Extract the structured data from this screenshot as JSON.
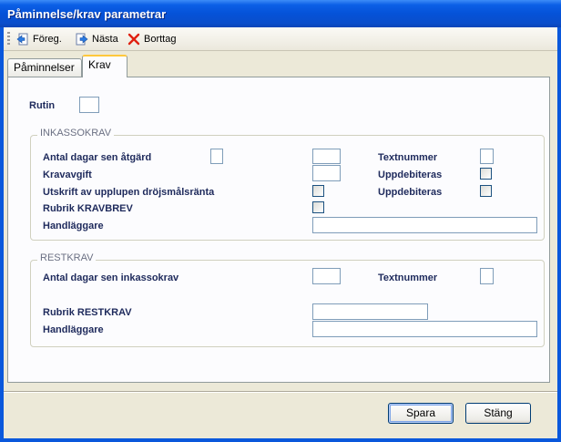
{
  "window": {
    "title": "Påminnelse/krav parametrar"
  },
  "toolbar": {
    "prev": "Föreg.",
    "next": "Nästa",
    "delete": "Borttag"
  },
  "tabs": [
    {
      "label": "Påminnelser"
    },
    {
      "label": "Krav"
    }
  ],
  "rutin": {
    "label": "Rutin",
    "value": ""
  },
  "inkassokrav": {
    "title": "INKASSOKRAV",
    "antal_dagar": "Antal dagar sen åtgärd",
    "textnummer": "Textnummer",
    "kravavgift": "Kravavgift",
    "uppdebiteras1": "Uppdebiteras",
    "utskrift": "Utskrift av upplupen dröjsmålsränta",
    "uppdebiteras2": "Uppdebiteras",
    "rubrik": "Rubrik KRAVBREV",
    "handlaggare": "Handläggare"
  },
  "restkrav": {
    "title": "RESTKRAV",
    "antal_dagar": "Antal dagar sen inkassokrav",
    "textnummer": "Textnummer",
    "rubrik": "Rubrik RESTKRAV",
    "handlaggare": "Handläggare"
  },
  "buttons": {
    "save": "Spara",
    "close": "Stäng"
  },
  "colors": {
    "titlebar": "#0552d8",
    "tab_highlight": "#ffc83c",
    "label": "#1e2a5c"
  }
}
